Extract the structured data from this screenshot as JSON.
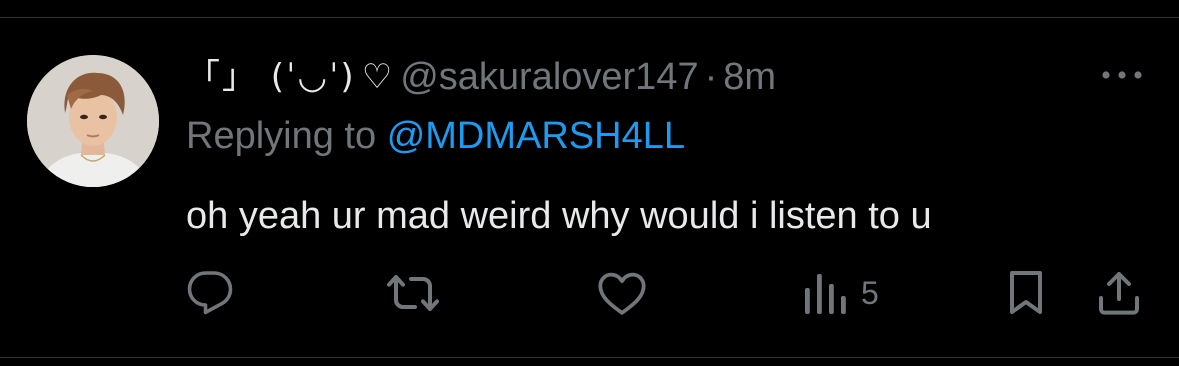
{
  "tweet": {
    "display_name": "「」 (ˈ◡ˈ)",
    "name_heart": "♡",
    "handle": "@sakuralover147",
    "separator": "·",
    "time": "8m",
    "replying_prefix": "Replying to",
    "replying_to": "@MDMARSH4LL",
    "text": "oh yeah ur mad weird why would i listen to u"
  },
  "actions": {
    "reply_icon": "reply-icon",
    "retweet_icon": "retweet-icon",
    "like_icon": "heart-icon",
    "views_icon": "views-icon",
    "views_count": "5",
    "bookmark_icon": "bookmark-icon",
    "share_icon": "share-icon"
  },
  "colors": {
    "background": "#000000",
    "text_primary": "#e7e9ea",
    "text_secondary": "#71767b",
    "link": "#1d9bf0",
    "divider": "#2f3336"
  }
}
